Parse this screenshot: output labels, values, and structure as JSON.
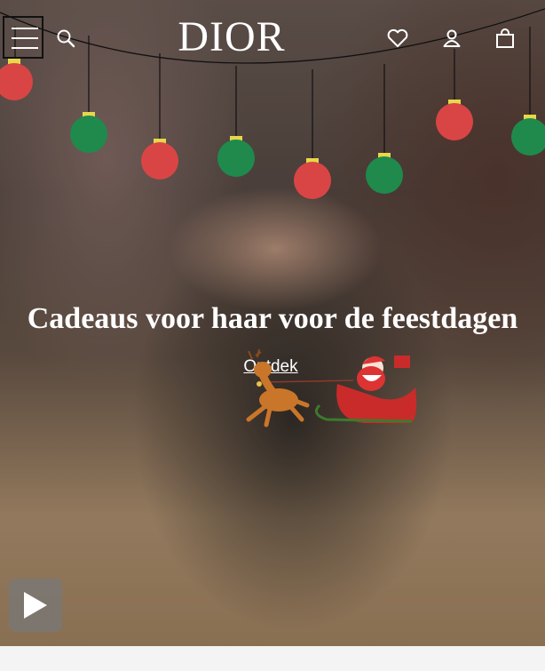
{
  "header": {
    "logo": "DIOR",
    "icons": [
      "menu-icon",
      "search-icon",
      "heart-icon",
      "user-icon",
      "bag-icon"
    ]
  },
  "hero": {
    "headline": "Cadeaus voor haar voor de feestdagen",
    "cta_label": "Ontdek"
  },
  "colors": {
    "ornament_red": "#d94545",
    "ornament_green": "#1f8a4c",
    "ornament_cap": "#e6d84a",
    "text": "#ffffff"
  }
}
